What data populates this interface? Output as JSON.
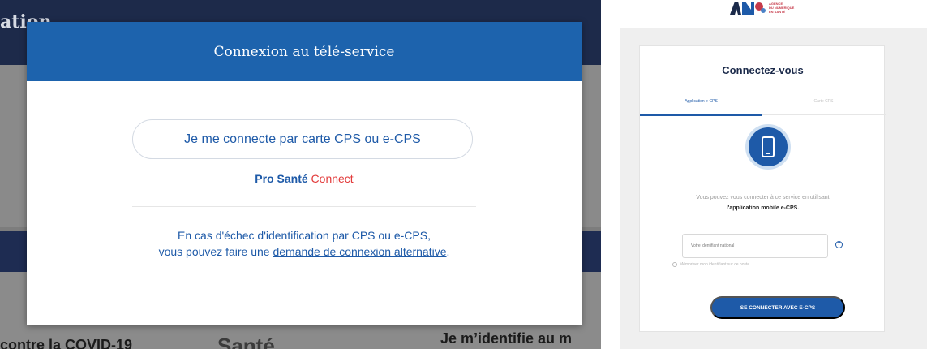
{
  "background_page": {
    "top_fragment": "ation",
    "bottom_left_text": "contre la COVID-19",
    "bottom_center_text": "Santé",
    "bottom_right_text": "Je m’identifie au m"
  },
  "modal": {
    "title": "Connexion au télé-service",
    "cps_button_label": "Je me connecte par carte CPS ou e-CPS",
    "psc_brand_pro": "Pro Santé",
    "psc_brand_connect": "Connect",
    "alt_text_line1": "En cas d'échec d'identification par CPS ou e-CPS,",
    "alt_text_line2_prefix": "vous pouvez faire une",
    "alt_link": "demande de connexion alternative",
    "alt_suffix": "."
  },
  "ans_logo": {
    "mark": "ANS",
    "line1": "AGENCE",
    "line2": "DU NUMÉRIQUE",
    "line3": "EN SANTÉ"
  },
  "login_card": {
    "title": "Connectez-vous",
    "tab_app": "Application e-CPS",
    "tab_card": "Carte CPS",
    "description_line1": "Vous pouvez vous connecter à ce service en utilisant",
    "description_line2": "l'application mobile e-CPS.",
    "id_placeholder": "Votre identifiant national",
    "remember_label": "Mémoriser mon identifiant sur ce poste",
    "connect_button": "SE CONNECTER AVEC E-CPS"
  },
  "colors": {
    "primary_blue": "#1d63ad",
    "brand_red": "#e23b3b",
    "navy": "#1e2c52"
  },
  "icons": [
    "phone-icon",
    "help-icon"
  ]
}
